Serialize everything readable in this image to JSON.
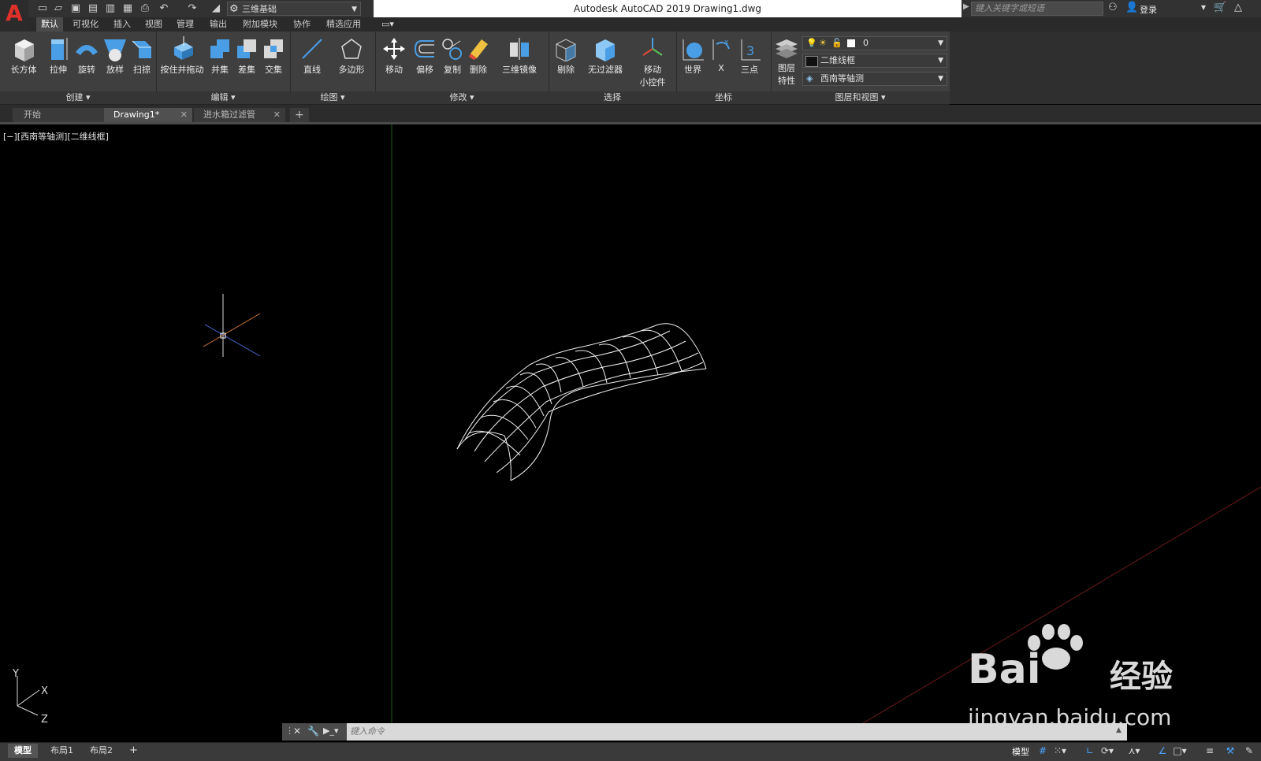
{
  "titlebar": {
    "workspace": "三维基础",
    "title": "Autodesk AutoCAD 2019    Drawing1.dwg",
    "search_placeholder": "键入关键字或短语",
    "login": "登录"
  },
  "ribbon_tabs": [
    "默认",
    "可视化",
    "插入",
    "视图",
    "管理",
    "输出",
    "附加模块",
    "协作",
    "精选应用"
  ],
  "groups": {
    "create": {
      "label": "创建",
      "tools": [
        "长方体",
        "拉伸",
        "旋转",
        "放样",
        "扫掠"
      ]
    },
    "edit": {
      "label": "编辑",
      "tools": [
        "按住并拖动",
        "并集",
        "差集",
        "交集"
      ]
    },
    "draw": {
      "label": "绘图",
      "tools": [
        "直线",
        "多边形"
      ]
    },
    "modify": {
      "label": "修改",
      "tools": [
        "移动",
        "偏移",
        "复制",
        "删除",
        "三维镜像"
      ]
    },
    "select": {
      "label": "选择",
      "tools": [
        "剔除",
        "无过滤器",
        "移动",
        "小控件"
      ]
    },
    "coords": {
      "label": "坐标",
      "tools": [
        "世界",
        "X",
        "三点"
      ]
    },
    "layers": {
      "label": "图层和视图",
      "tool1": "图层",
      "tool2": "特性",
      "layer_value": "0",
      "visual_style": "二维线框",
      "view": "西南等轴测"
    }
  },
  "file_tabs": [
    "开始",
    "Drawing1*",
    "进水箱过滤管"
  ],
  "viewport": {
    "label": "[−][西南等轴测][二维线框]",
    "ucs_y": "Y",
    "ucs_x": "X",
    "ucs_z": "Z"
  },
  "command": {
    "placeholder": "键入命令"
  },
  "layout_tabs": [
    "模型",
    "布局1",
    "布局2"
  ],
  "status": {
    "model": "模型"
  },
  "watermark": {
    "brand": "Bai",
    "brand2": "经验",
    "url": "jingyan.baidu.com"
  },
  "colors": {
    "accent": "#4aa3ff",
    "logo": "#e0302a",
    "background": "#000000"
  }
}
